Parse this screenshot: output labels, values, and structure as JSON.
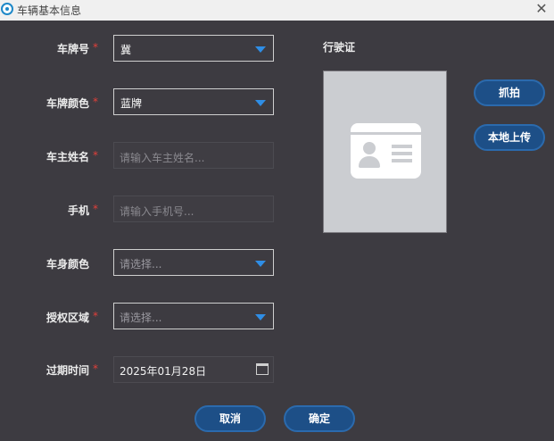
{
  "window": {
    "title": "车辆基本信息",
    "close_glyph": "✕"
  },
  "form": {
    "plate_number": {
      "label": "车牌号",
      "required": "*",
      "value": "冀"
    },
    "plate_color": {
      "label": "车牌颜色",
      "required": "*",
      "value": "蓝牌"
    },
    "owner_name": {
      "label": "车主姓名",
      "required": "*",
      "placeholder": "请输入车主姓名..."
    },
    "phone": {
      "label": "手机",
      "required": "*",
      "placeholder": "请输入手机号..."
    },
    "body_color": {
      "label": "车身颜色",
      "placeholder": "请选择..."
    },
    "auth_area": {
      "label": "授权区域",
      "required": "*",
      "placeholder": "请选择..."
    },
    "expiry": {
      "label": "过期时间",
      "required": "*",
      "value": "2025年01月28日"
    }
  },
  "license": {
    "label": "行驶证",
    "capture_button": "抓拍",
    "upload_button": "本地上传"
  },
  "footer": {
    "cancel_button": "取消",
    "confirm_button": "确定"
  },
  "colors": {
    "background": "#3d3b41",
    "accent": "#2f8ee6",
    "button": "#1d4f87",
    "required": "#e0403a"
  }
}
